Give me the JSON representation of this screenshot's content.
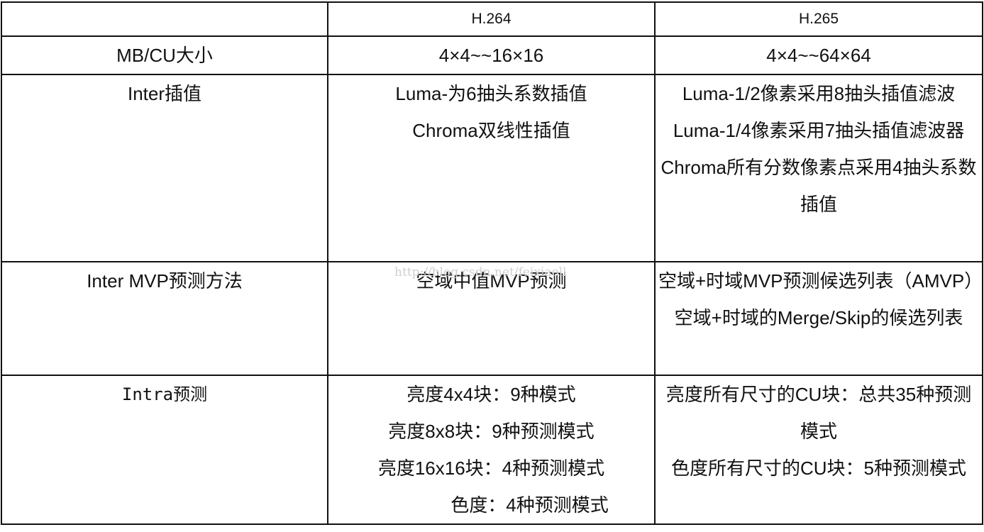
{
  "table": {
    "header": {
      "corner": "",
      "h264": "H.264",
      "h265": "H.265"
    },
    "rows": [
      {
        "label": "MB/CU大小",
        "h264": [
          "4×4~~16×16"
        ],
        "h265": [
          "4×4~~64×64"
        ]
      },
      {
        "label": "Inter插值",
        "h264": [
          "Luma-为6抽头系数插值",
          "Chroma双线性插值"
        ],
        "h265": [
          "Luma-1/2像素采用8抽头插值滤波",
          "Luma-1/4像素采用7抽头插值滤波器",
          "Chroma所有分数像素点采用4抽头系数插值"
        ]
      },
      {
        "label": "Inter MVP预测方法",
        "h264": [
          "空域中值MVP预测"
        ],
        "h265": [
          "空域+时域MVP预测候选列表（AMVP）",
          "空域+时域的Merge/Skip的候选列表"
        ]
      },
      {
        "label": "Intra预测",
        "h264": [
          "亮度4x4块：9种模式",
          "亮度8x8块：9种预测模式",
          "亮度16x16块：4种预测模式",
          "色度：4种预测模式"
        ],
        "h265": [
          "亮度所有尺寸的CU块：总共35种预测模式",
          "色度所有尺寸的CU块：5种预测模式"
        ]
      }
    ]
  },
  "watermark": "http://blog.csdn.net/feixiaoll"
}
